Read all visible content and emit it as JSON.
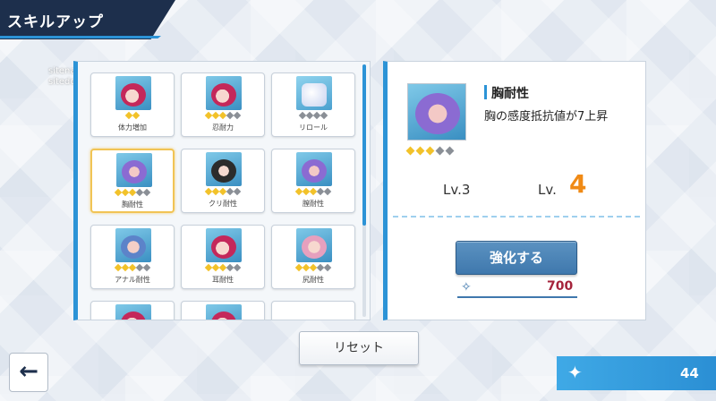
{
  "header": {
    "title": "スキルアップ"
  },
  "watermark": {
    "line1": "sitename: 上漫游戏",
    "line2": "sitedomain:https://fxacg.cc"
  },
  "skills": [
    {
      "label": "体力増加",
      "level": 2,
      "max": 2,
      "thumb": "hair",
      "icon": "skill-thumbnail-icon"
    },
    {
      "label": "忍耐力",
      "level": 3,
      "max": 5,
      "thumb": "hair",
      "icon": "skill-thumbnail-icon"
    },
    {
      "label": "リロール",
      "level": 0,
      "max": 4,
      "thumb": "dice",
      "icon": "dice-icon"
    },
    {
      "label": "胸耐性",
      "level": 3,
      "max": 5,
      "thumb": "purple",
      "icon": "skill-thumbnail-icon"
    },
    {
      "label": "クリ耐性",
      "level": 3,
      "max": 5,
      "thumb": "dark",
      "icon": "skill-thumbnail-icon"
    },
    {
      "label": "膣耐性",
      "level": 3,
      "max": 5,
      "thumb": "purple",
      "icon": "skill-thumbnail-icon"
    },
    {
      "label": "アナル耐性",
      "level": 3,
      "max": 5,
      "thumb": "blue",
      "icon": "skill-thumbnail-icon"
    },
    {
      "label": "耳耐性",
      "level": 3,
      "max": 5,
      "thumb": "hair",
      "icon": "skill-thumbnail-icon"
    },
    {
      "label": "尻耐性",
      "level": 3,
      "max": 5,
      "thumb": "pink",
      "icon": "skill-thumbnail-icon"
    }
  ],
  "selected_index": 3,
  "detail": {
    "name": "胸耐性",
    "description": "胸の感度抵抗値が7上昇",
    "level_filled": 3,
    "level_max": 5,
    "current_level": "Lv.3",
    "next_level_prefix": "Lv.",
    "next_level_value": "4",
    "upgrade_label": "強化する",
    "cost": "700"
  },
  "reset_label": "リセット",
  "back_arrow": "←",
  "currency": {
    "value": "44",
    "icon": "sparkle-icon"
  },
  "colors": {
    "accent": "#2c93d6",
    "header": "#1d2f4c",
    "gold": "#f2c22a",
    "orange": "#f08a15",
    "cost": "#a5233b"
  }
}
